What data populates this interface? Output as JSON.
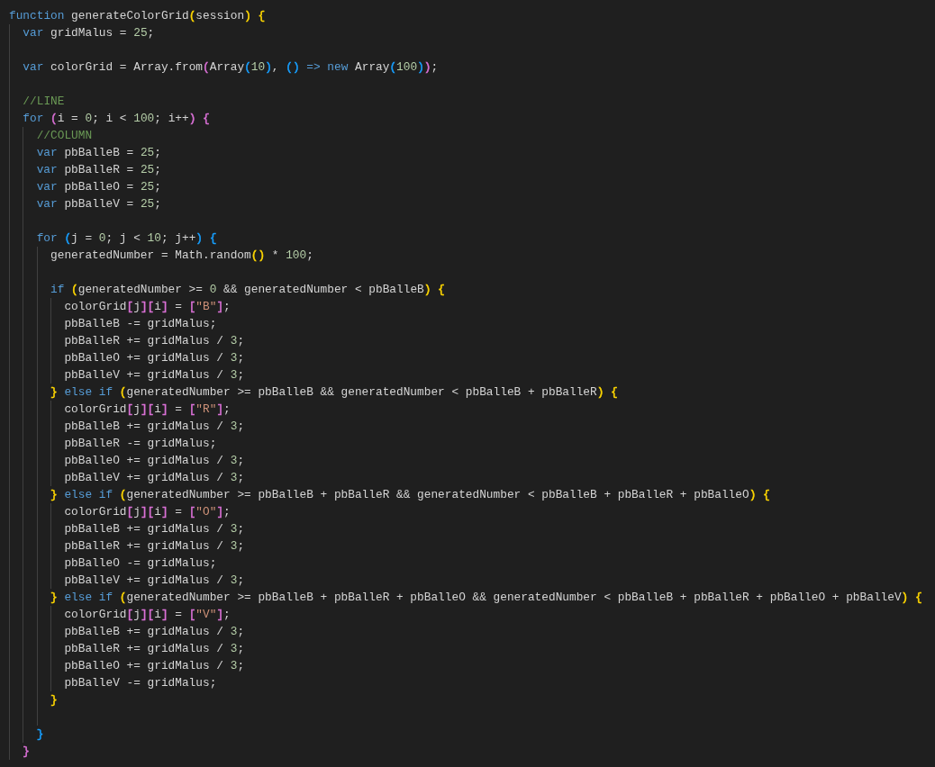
{
  "editor": {
    "lines": [
      {
        "kind": "code",
        "tokens": [
          {
            "kind": "kw",
            "text": "function"
          },
          {
            "kind": "plain",
            "text": " generateColorGrid"
          },
          {
            "kind": "br",
            "text": "(",
            "color": "#ffd700"
          },
          {
            "kind": "plain",
            "text": "session"
          },
          {
            "kind": "br",
            "text": ")",
            "color": "#ffd700"
          },
          {
            "kind": "br",
            "text": " {",
            "color": "#ffd700"
          }
        ],
        "children": [
          {
            "kind": "code",
            "tokens": [
              {
                "kind": "kw",
                "text": "var"
              },
              {
                "kind": "plain",
                "text": " gridMalus = "
              },
              {
                "kind": "num",
                "text": "25"
              },
              {
                "kind": "plain",
                "text": ";"
              }
            ]
          },
          {
            "kind": "blank"
          },
          {
            "kind": "code",
            "tokens": [
              {
                "kind": "kw",
                "text": "var"
              },
              {
                "kind": "plain",
                "text": " colorGrid = Array.from"
              },
              {
                "kind": "br",
                "text": "(",
                "color": "#da70d6"
              },
              {
                "kind": "plain",
                "text": "Array"
              },
              {
                "kind": "br",
                "text": "(",
                "color": "#179fff"
              },
              {
                "kind": "num",
                "text": "10"
              },
              {
                "kind": "br",
                "text": ")",
                "color": "#179fff"
              },
              {
                "kind": "plain",
                "text": ", "
              },
              {
                "kind": "br",
                "text": "()",
                "color": "#179fff"
              },
              {
                "kind": "kw",
                "text": " =>"
              },
              {
                "kind": "kw",
                "text": " new"
              },
              {
                "kind": "plain",
                "text": " Array"
              },
              {
                "kind": "br",
                "text": "(",
                "color": "#179fff"
              },
              {
                "kind": "num",
                "text": "100"
              },
              {
                "kind": "br",
                "text": ")",
                "color": "#179fff"
              },
              {
                "kind": "br",
                "text": ")",
                "color": "#da70d6"
              },
              {
                "kind": "plain",
                "text": ";"
              }
            ]
          },
          {
            "kind": "blank"
          },
          {
            "kind": "code",
            "tokens": [
              {
                "kind": "com",
                "text": "//LINE"
              }
            ]
          },
          {
            "kind": "code",
            "tokens": [
              {
                "kind": "kw",
                "text": "for"
              },
              {
                "kind": "br",
                "text": " (",
                "color": "#da70d6"
              },
              {
                "kind": "plain",
                "text": "i = "
              },
              {
                "kind": "num",
                "text": "0"
              },
              {
                "kind": "plain",
                "text": "; i < "
              },
              {
                "kind": "num",
                "text": "100"
              },
              {
                "kind": "plain",
                "text": "; i++"
              },
              {
                "kind": "br",
                "text": ")",
                "color": "#da70d6"
              },
              {
                "kind": "br",
                "text": " {",
                "color": "#da70d6"
              }
            ],
            "children": [
              {
                "kind": "code",
                "tokens": [
                  {
                    "kind": "com",
                    "text": "//COLUMN"
                  }
                ]
              },
              {
                "kind": "code",
                "tokens": [
                  {
                    "kind": "kw",
                    "text": "var"
                  },
                  {
                    "kind": "plain",
                    "text": " pbBalleB = "
                  },
                  {
                    "kind": "num",
                    "text": "25"
                  },
                  {
                    "kind": "plain",
                    "text": ";"
                  }
                ]
              },
              {
                "kind": "code",
                "tokens": [
                  {
                    "kind": "kw",
                    "text": "var"
                  },
                  {
                    "kind": "plain",
                    "text": " pbBalleR = "
                  },
                  {
                    "kind": "num",
                    "text": "25"
                  },
                  {
                    "kind": "plain",
                    "text": ";"
                  }
                ]
              },
              {
                "kind": "code",
                "tokens": [
                  {
                    "kind": "kw",
                    "text": "var"
                  },
                  {
                    "kind": "plain",
                    "text": " pbBalleO = "
                  },
                  {
                    "kind": "num",
                    "text": "25"
                  },
                  {
                    "kind": "plain",
                    "text": ";"
                  }
                ]
              },
              {
                "kind": "code",
                "tokens": [
                  {
                    "kind": "kw",
                    "text": "var"
                  },
                  {
                    "kind": "plain",
                    "text": " pbBalleV = "
                  },
                  {
                    "kind": "num",
                    "text": "25"
                  },
                  {
                    "kind": "plain",
                    "text": ";"
                  }
                ]
              },
              {
                "kind": "blank"
              },
              {
                "kind": "code",
                "tokens": [
                  {
                    "kind": "kw",
                    "text": "for"
                  },
                  {
                    "kind": "br",
                    "text": " (",
                    "color": "#179fff"
                  },
                  {
                    "kind": "plain",
                    "text": "j = "
                  },
                  {
                    "kind": "num",
                    "text": "0"
                  },
                  {
                    "kind": "plain",
                    "text": "; j < "
                  },
                  {
                    "kind": "num",
                    "text": "10"
                  },
                  {
                    "kind": "plain",
                    "text": "; j++"
                  },
                  {
                    "kind": "br",
                    "text": ")",
                    "color": "#179fff"
                  },
                  {
                    "kind": "br",
                    "text": " {",
                    "color": "#179fff"
                  }
                ],
                "children": [
                  {
                    "kind": "code",
                    "tokens": [
                      {
                        "kind": "plain",
                        "text": "generatedNumber = Math.random"
                      },
                      {
                        "kind": "br",
                        "text": "()",
                        "color": "#ffd700"
                      },
                      {
                        "kind": "plain",
                        "text": " * "
                      },
                      {
                        "kind": "num",
                        "text": "100"
                      },
                      {
                        "kind": "plain",
                        "text": ";"
                      }
                    ]
                  },
                  {
                    "kind": "blank"
                  },
                  {
                    "kind": "code",
                    "tokens": [
                      {
                        "kind": "kw",
                        "text": "if"
                      },
                      {
                        "kind": "br",
                        "text": " (",
                        "color": "#ffd700"
                      },
                      {
                        "kind": "plain",
                        "text": "generatedNumber >= "
                      },
                      {
                        "kind": "num",
                        "text": "0"
                      },
                      {
                        "kind": "plain",
                        "text": " && generatedNumber < pbBalleB"
                      },
                      {
                        "kind": "br",
                        "text": ")",
                        "color": "#ffd700"
                      },
                      {
                        "kind": "br",
                        "text": " {",
                        "color": "#ffd700"
                      }
                    ],
                    "children": [
                      {
                        "kind": "code",
                        "tokens": [
                          {
                            "kind": "plain",
                            "text": "colorGrid"
                          },
                          {
                            "kind": "br",
                            "text": "[",
                            "color": "#da70d6"
                          },
                          {
                            "kind": "plain",
                            "text": "j"
                          },
                          {
                            "kind": "br",
                            "text": "][",
                            "color": "#da70d6"
                          },
                          {
                            "kind": "plain",
                            "text": "i"
                          },
                          {
                            "kind": "br",
                            "text": "]",
                            "color": "#da70d6"
                          },
                          {
                            "kind": "plain",
                            "text": " = "
                          },
                          {
                            "kind": "br",
                            "text": "[",
                            "color": "#da70d6"
                          },
                          {
                            "kind": "str",
                            "text": "\"B\""
                          },
                          {
                            "kind": "br",
                            "text": "]",
                            "color": "#da70d6"
                          },
                          {
                            "kind": "plain",
                            "text": ";"
                          }
                        ]
                      },
                      {
                        "kind": "code",
                        "tokens": [
                          {
                            "kind": "plain",
                            "text": "pbBalleB -= gridMalus;"
                          }
                        ]
                      },
                      {
                        "kind": "code",
                        "tokens": [
                          {
                            "kind": "plain",
                            "text": "pbBalleR += gridMalus / "
                          },
                          {
                            "kind": "num",
                            "text": "3"
                          },
                          {
                            "kind": "plain",
                            "text": ";"
                          }
                        ]
                      },
                      {
                        "kind": "code",
                        "tokens": [
                          {
                            "kind": "plain",
                            "text": "pbBalleO += gridMalus / "
                          },
                          {
                            "kind": "num",
                            "text": "3"
                          },
                          {
                            "kind": "plain",
                            "text": ";"
                          }
                        ]
                      },
                      {
                        "kind": "code",
                        "tokens": [
                          {
                            "kind": "plain",
                            "text": "pbBalleV += gridMalus / "
                          },
                          {
                            "kind": "num",
                            "text": "3"
                          },
                          {
                            "kind": "plain",
                            "text": ";"
                          }
                        ]
                      }
                    ]
                  },
                  {
                    "kind": "code",
                    "tokens": [
                      {
                        "kind": "br",
                        "text": "}",
                        "color": "#ffd700"
                      },
                      {
                        "kind": "kw",
                        "text": " else if"
                      },
                      {
                        "kind": "br",
                        "text": " (",
                        "color": "#ffd700"
                      },
                      {
                        "kind": "plain",
                        "text": "generatedNumber >= pbBalleB && generatedNumber < pbBalleB + pbBalleR"
                      },
                      {
                        "kind": "br",
                        "text": ")",
                        "color": "#ffd700"
                      },
                      {
                        "kind": "br",
                        "text": " {",
                        "color": "#ffd700"
                      }
                    ],
                    "children": [
                      {
                        "kind": "code",
                        "tokens": [
                          {
                            "kind": "plain",
                            "text": "colorGrid"
                          },
                          {
                            "kind": "br",
                            "text": "[",
                            "color": "#da70d6"
                          },
                          {
                            "kind": "plain",
                            "text": "j"
                          },
                          {
                            "kind": "br",
                            "text": "][",
                            "color": "#da70d6"
                          },
                          {
                            "kind": "plain",
                            "text": "i"
                          },
                          {
                            "kind": "br",
                            "text": "]",
                            "color": "#da70d6"
                          },
                          {
                            "kind": "plain",
                            "text": " = "
                          },
                          {
                            "kind": "br",
                            "text": "[",
                            "color": "#da70d6"
                          },
                          {
                            "kind": "str",
                            "text": "\"R\""
                          },
                          {
                            "kind": "br",
                            "text": "]",
                            "color": "#da70d6"
                          },
                          {
                            "kind": "plain",
                            "text": ";"
                          }
                        ]
                      },
                      {
                        "kind": "code",
                        "tokens": [
                          {
                            "kind": "plain",
                            "text": "pbBalleB += gridMalus / "
                          },
                          {
                            "kind": "num",
                            "text": "3"
                          },
                          {
                            "kind": "plain",
                            "text": ";"
                          }
                        ]
                      },
                      {
                        "kind": "code",
                        "tokens": [
                          {
                            "kind": "plain",
                            "text": "pbBalleR -= gridMalus;"
                          }
                        ]
                      },
                      {
                        "kind": "code",
                        "tokens": [
                          {
                            "kind": "plain",
                            "text": "pbBalleO += gridMalus / "
                          },
                          {
                            "kind": "num",
                            "text": "3"
                          },
                          {
                            "kind": "plain",
                            "text": ";"
                          }
                        ]
                      },
                      {
                        "kind": "code",
                        "tokens": [
                          {
                            "kind": "plain",
                            "text": "pbBalleV += gridMalus / "
                          },
                          {
                            "kind": "num",
                            "text": "3"
                          },
                          {
                            "kind": "plain",
                            "text": ";"
                          }
                        ]
                      }
                    ]
                  },
                  {
                    "kind": "code",
                    "tokens": [
                      {
                        "kind": "br",
                        "text": "}",
                        "color": "#ffd700"
                      },
                      {
                        "kind": "kw",
                        "text": " else if"
                      },
                      {
                        "kind": "br",
                        "text": " (",
                        "color": "#ffd700"
                      },
                      {
                        "kind": "plain",
                        "text": "generatedNumber >= pbBalleB + pbBalleR && generatedNumber < pbBalleB + pbBalleR + pbBalleO"
                      },
                      {
                        "kind": "br",
                        "text": ")",
                        "color": "#ffd700"
                      },
                      {
                        "kind": "br",
                        "text": " {",
                        "color": "#ffd700"
                      }
                    ],
                    "children": [
                      {
                        "kind": "code",
                        "tokens": [
                          {
                            "kind": "plain",
                            "text": "colorGrid"
                          },
                          {
                            "kind": "br",
                            "text": "[",
                            "color": "#da70d6"
                          },
                          {
                            "kind": "plain",
                            "text": "j"
                          },
                          {
                            "kind": "br",
                            "text": "][",
                            "color": "#da70d6"
                          },
                          {
                            "kind": "plain",
                            "text": "i"
                          },
                          {
                            "kind": "br",
                            "text": "]",
                            "color": "#da70d6"
                          },
                          {
                            "kind": "plain",
                            "text": " = "
                          },
                          {
                            "kind": "br",
                            "text": "[",
                            "color": "#da70d6"
                          },
                          {
                            "kind": "str",
                            "text": "\"O\""
                          },
                          {
                            "kind": "br",
                            "text": "]",
                            "color": "#da70d6"
                          },
                          {
                            "kind": "plain",
                            "text": ";"
                          }
                        ]
                      },
                      {
                        "kind": "code",
                        "tokens": [
                          {
                            "kind": "plain",
                            "text": "pbBalleB += gridMalus / "
                          },
                          {
                            "kind": "num",
                            "text": "3"
                          },
                          {
                            "kind": "plain",
                            "text": ";"
                          }
                        ]
                      },
                      {
                        "kind": "code",
                        "tokens": [
                          {
                            "kind": "plain",
                            "text": "pbBalleR += gridMalus / "
                          },
                          {
                            "kind": "num",
                            "text": "3"
                          },
                          {
                            "kind": "plain",
                            "text": ";"
                          }
                        ]
                      },
                      {
                        "kind": "code",
                        "tokens": [
                          {
                            "kind": "plain",
                            "text": "pbBalleO -= gridMalus;"
                          }
                        ]
                      },
                      {
                        "kind": "code",
                        "tokens": [
                          {
                            "kind": "plain",
                            "text": "pbBalleV += gridMalus / "
                          },
                          {
                            "kind": "num",
                            "text": "3"
                          },
                          {
                            "kind": "plain",
                            "text": ";"
                          }
                        ]
                      }
                    ]
                  },
                  {
                    "kind": "code",
                    "tokens": [
                      {
                        "kind": "br",
                        "text": "}",
                        "color": "#ffd700"
                      },
                      {
                        "kind": "kw",
                        "text": " else if"
                      },
                      {
                        "kind": "br",
                        "text": " (",
                        "color": "#ffd700"
                      },
                      {
                        "kind": "plain",
                        "text": "generatedNumber >= pbBalleB + pbBalleR + pbBalleO && generatedNumber < pbBalleB + pbBalleR + pbBalleO + pbBalleV"
                      },
                      {
                        "kind": "br",
                        "text": ")",
                        "color": "#ffd700"
                      },
                      {
                        "kind": "br",
                        "text": " {",
                        "color": "#ffd700"
                      }
                    ],
                    "children": [
                      {
                        "kind": "code",
                        "tokens": [
                          {
                            "kind": "plain",
                            "text": "colorGrid"
                          },
                          {
                            "kind": "br",
                            "text": "[",
                            "color": "#da70d6"
                          },
                          {
                            "kind": "plain",
                            "text": "j"
                          },
                          {
                            "kind": "br",
                            "text": "][",
                            "color": "#da70d6"
                          },
                          {
                            "kind": "plain",
                            "text": "i"
                          },
                          {
                            "kind": "br",
                            "text": "]",
                            "color": "#da70d6"
                          },
                          {
                            "kind": "plain",
                            "text": " = "
                          },
                          {
                            "kind": "br",
                            "text": "[",
                            "color": "#da70d6"
                          },
                          {
                            "kind": "str",
                            "text": "\"V\""
                          },
                          {
                            "kind": "br",
                            "text": "]",
                            "color": "#da70d6"
                          },
                          {
                            "kind": "plain",
                            "text": ";"
                          }
                        ]
                      },
                      {
                        "kind": "code",
                        "tokens": [
                          {
                            "kind": "plain",
                            "text": "pbBalleB += gridMalus / "
                          },
                          {
                            "kind": "num",
                            "text": "3"
                          },
                          {
                            "kind": "plain",
                            "text": ";"
                          }
                        ]
                      },
                      {
                        "kind": "code",
                        "tokens": [
                          {
                            "kind": "plain",
                            "text": "pbBalleR += gridMalus / "
                          },
                          {
                            "kind": "num",
                            "text": "3"
                          },
                          {
                            "kind": "plain",
                            "text": ";"
                          }
                        ]
                      },
                      {
                        "kind": "code",
                        "tokens": [
                          {
                            "kind": "plain",
                            "text": "pbBalleO += gridMalus / "
                          },
                          {
                            "kind": "num",
                            "text": "3"
                          },
                          {
                            "kind": "plain",
                            "text": ";"
                          }
                        ]
                      },
                      {
                        "kind": "code",
                        "tokens": [
                          {
                            "kind": "plain",
                            "text": "pbBalleV -= gridMalus;"
                          }
                        ]
                      }
                    ]
                  },
                  {
                    "kind": "code",
                    "tokens": [
                      {
                        "kind": "br",
                        "text": "}",
                        "color": "#ffd700"
                      }
                    ]
                  },
                  {
                    "kind": "blank"
                  }
                ]
              },
              {
                "kind": "code",
                "tokens": [
                  {
                    "kind": "br",
                    "text": "}",
                    "color": "#179fff"
                  }
                ]
              }
            ]
          },
          {
            "kind": "code",
            "tokens": [
              {
                "kind": "br",
                "text": "}",
                "color": "#da70d6"
              }
            ]
          }
        ]
      }
    ]
  }
}
